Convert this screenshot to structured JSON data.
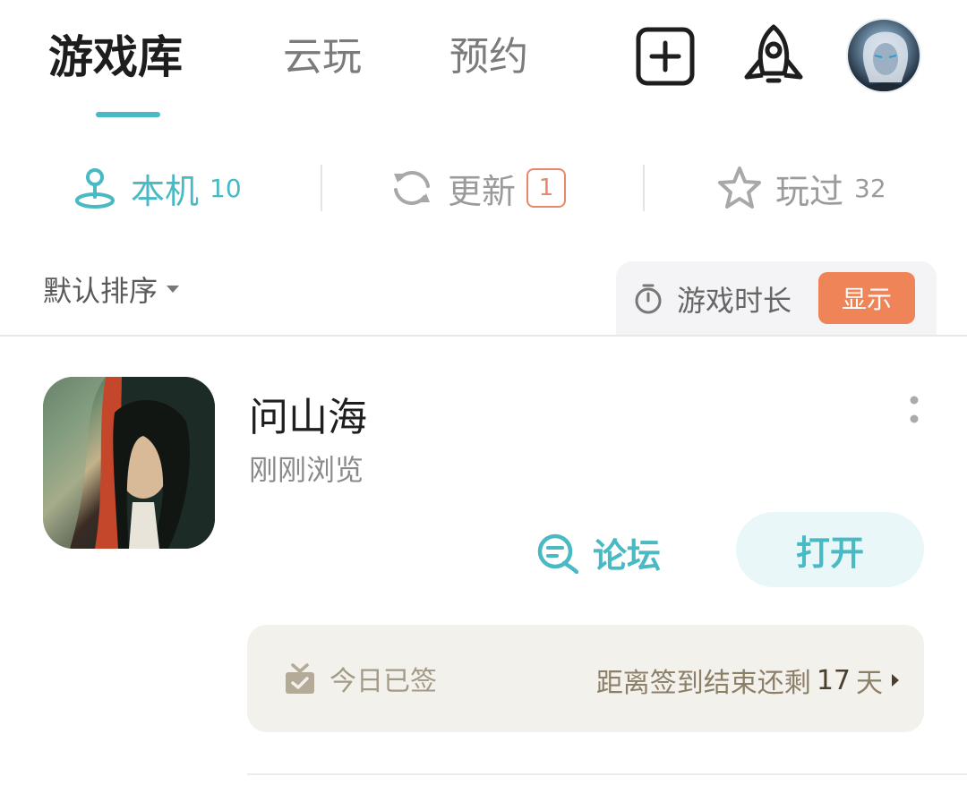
{
  "top_tabs": {
    "active_label": "游戏库",
    "cloud_label": "云玩",
    "reserve_label": "预约"
  },
  "sub_tabs": {
    "local": {
      "label": "本机",
      "count": "10"
    },
    "update": {
      "label": "更新",
      "badge": "1"
    },
    "played": {
      "label": "玩过",
      "count": "32"
    }
  },
  "sort": {
    "label": "默认排序"
  },
  "playtime": {
    "label": "游戏时长",
    "button": "显示"
  },
  "game": {
    "title": "问山海",
    "subtitle": "刚刚浏览",
    "forum_label": "论坛",
    "open_label": "打开"
  },
  "sign": {
    "status": "今日已签",
    "remain_prefix": "距离签到结束还剩",
    "remain_days": "17",
    "remain_suffix": "天"
  },
  "colors": {
    "accent": "#49b9c3",
    "orange": "#ef8459",
    "badge": "#e8886a"
  },
  "icons": [
    "add-icon",
    "rocket-icon",
    "avatar",
    "location-person-icon",
    "refresh-icon",
    "star-icon",
    "timer-icon",
    "chat-icon",
    "gift-check-icon",
    "more-icon"
  ]
}
